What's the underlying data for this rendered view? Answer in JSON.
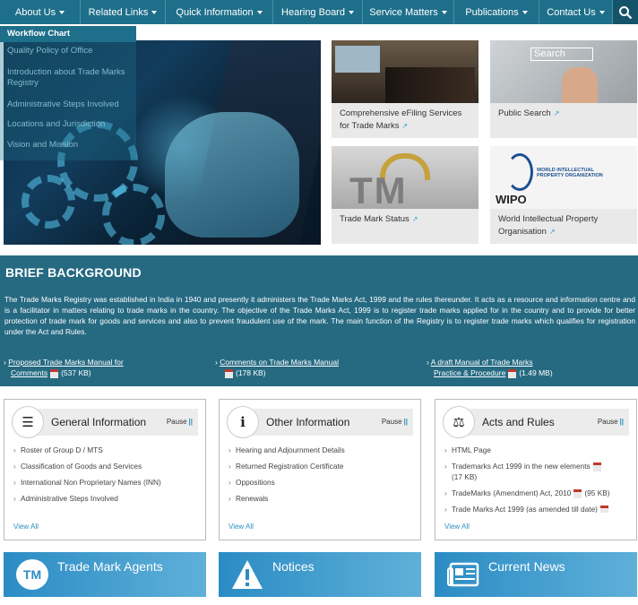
{
  "nav": {
    "items": [
      {
        "label": "About Us"
      },
      {
        "label": "Related Links"
      },
      {
        "label": "Quick Information"
      },
      {
        "label": "Hearing Board"
      },
      {
        "label": "Service Matters"
      },
      {
        "label": "Publications"
      },
      {
        "label": "Contact Us"
      }
    ],
    "search_icon": "search-icon"
  },
  "about_submenu": [
    "Workflow Chart",
    "Quality Policy of Office",
    "Introduction about Trade Marks Registry",
    "Administrative Steps Involved",
    "Locations and Jurisdiction",
    "Vision and Mission"
  ],
  "tiles": [
    {
      "caption": "Comprehensive eFiling Services for Trade Marks"
    },
    {
      "caption": "Public Search",
      "image_text": "Search"
    },
    {
      "caption": "Trade Mark Status",
      "image_text": "TM"
    },
    {
      "caption": "World Intellectual Property Organisation",
      "image_text": "WIPO",
      "image_subtext": "WORLD INTELLECTUAL PROPERTY ORGANIZATION"
    }
  ],
  "brief": {
    "title": "BRIEF BACKGROUND",
    "text": "The Trade Marks Registry was established in India in 1940 and presently it administers the Trade Marks Act, 1999 and the rules thereunder. It acts as a resource and information centre and is a facilitator in matters relating to trade marks in the country. The objective of the Trade Marks Act, 1999 is to register trade marks applied for in the country and to provide for better protection of trade mark for goods and services and also to prevent fraudulent use of the mark. The main function of the Registry is to register trade marks which qualifies for registration under the Act and Rules."
  },
  "downloads": [
    {
      "line1": "Proposed Trade Marks Manual for",
      "line2": "Comments",
      "size": "(537 KB)"
    },
    {
      "line1": "Comments on Trade Marks Manual",
      "line2": "",
      "size": "(178 KB)"
    },
    {
      "line1": "A draft Manual of Trade Marks",
      "line2": "Practice & Procedure",
      "size": "(1.49 MB)"
    }
  ],
  "cards": [
    {
      "title": "General Information",
      "pause": "Pause",
      "icon": "list-icon",
      "view_all": "View All",
      "items": [
        "Roster of Group D / MTS",
        "Classification of Goods and Services",
        "International Non Proprietary Names (INN)",
        "Administrative Steps Involved"
      ]
    },
    {
      "title": "Other Information",
      "pause": "Pause",
      "icon": "info-icon",
      "view_all": "View All",
      "items": [
        "Hearing and Adjournment Details",
        "Returned Registration Certificate",
        "Oppositions",
        "Renewals"
      ]
    },
    {
      "title": "Acts and Rules",
      "pause": "Pause",
      "icon": "gavel-icon",
      "view_all": "View All",
      "items": [
        "HTML Page",
        "Trademarks Act 1999 in the new elements",
        "(17 KB)",
        "TradeMarks (Amendment) Act, 2010",
        "(95 KB)",
        "Trade Marks Act 1999 (as amended till date)"
      ]
    }
  ],
  "banners": [
    {
      "label": "Trade Mark Agents",
      "icon_text": "TM"
    },
    {
      "label": "Notices",
      "icon": "warning-icon"
    },
    {
      "label": "Current News",
      "icon": "newspaper-icon"
    }
  ],
  "colors": {
    "nav": "#1e6f8a",
    "brief_bg": "#266a82",
    "accent": "#2a8fc0"
  }
}
